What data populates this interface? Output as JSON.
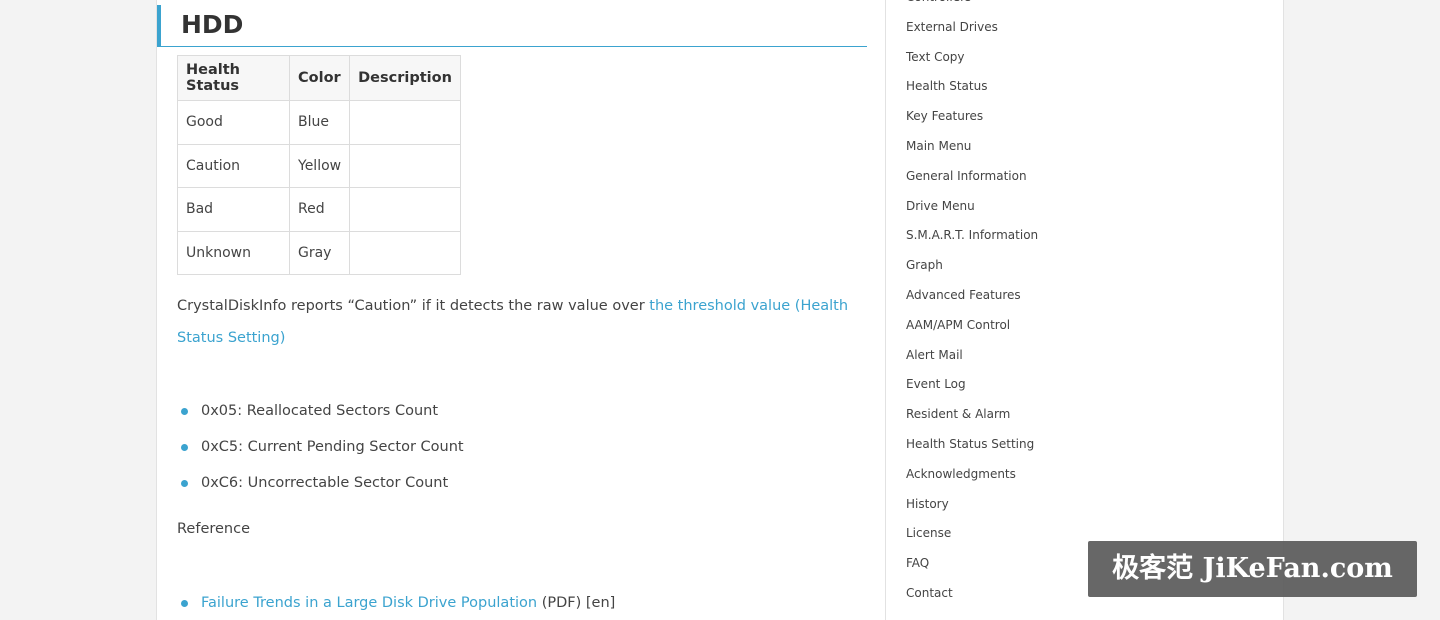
{
  "article": {
    "heading": "HDD",
    "table": {
      "headers": [
        "Health Status",
        "Color",
        "Description"
      ],
      "rows": [
        [
          "Good",
          "Blue",
          ""
        ],
        [
          "Caution",
          "Yellow",
          ""
        ],
        [
          "Bad",
          "Red",
          ""
        ],
        [
          "Unknown",
          "Gray",
          ""
        ]
      ]
    },
    "paragraph": {
      "text": "CrystalDiskInfo reports “Caution” if it detects the raw value over ",
      "link_text": "the threshold value (Health Status Setting)"
    },
    "attributes": [
      "0x05: Reallocated Sectors Count",
      "0xC5: Current Pending Sector Count",
      "0xC6: Uncorrectable Sector Count"
    ],
    "reference_label": "Reference",
    "references": [
      {
        "link_text": "Failure Trends in a Large Disk Drive Population",
        "suffix": " (PDF) [en]"
      }
    ]
  },
  "sidebar": {
    "items": [
      "Controllers",
      "External Drives",
      "Text Copy",
      "Health Status",
      "Key Features",
      "Main Menu",
      "General Information",
      "Drive Menu",
      "S.M.A.R.T. Information",
      "Graph",
      "Advanced Features",
      "AAM/APM Control",
      "Alert Mail",
      "Event Log",
      "Resident & Alarm",
      "Health Status Setting",
      "Acknowledgments",
      "History",
      "License",
      "FAQ",
      "Contact"
    ]
  },
  "watermark": {
    "text": "极客范 JiKeFan.com"
  },
  "colors": {
    "accent": "#3ba3cf"
  }
}
